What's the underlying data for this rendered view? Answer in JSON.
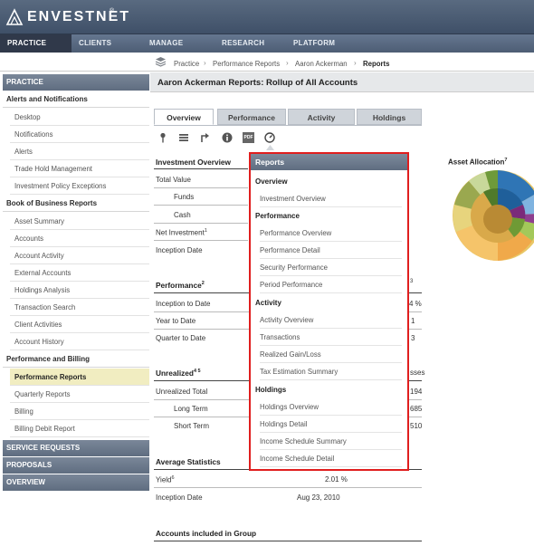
{
  "brand": {
    "name": "ENVESTNET",
    "tm": "®"
  },
  "nav": {
    "tabs": [
      {
        "label": "PRACTICE"
      },
      {
        "label": "CLIENTS"
      },
      {
        "label": "MANAGE"
      },
      {
        "label": "RESEARCH"
      },
      {
        "label": "PLATFORM"
      }
    ]
  },
  "breadcrumb": [
    "Practice",
    "Performance Reports",
    "Aaron Ackerman",
    "Reports"
  ],
  "sidebar": {
    "practice_title": "PRACTICE",
    "groups": [
      {
        "heading": "Alerts and Notifications",
        "items": [
          "Desktop",
          "Notifications",
          "Alerts",
          "Trade Hold Management",
          "Investment Policy Exceptions"
        ]
      },
      {
        "heading": "Book of Business Reports",
        "items": [
          "Asset Summary",
          "Accounts",
          "Account Activity",
          "External Accounts",
          "Holdings Analysis",
          "Transaction Search",
          "Client Activities",
          "Account History"
        ]
      },
      {
        "heading": "Performance and Billing",
        "items": [
          "Performance Reports",
          "Quarterly Reports",
          "Billing",
          "Billing Debit Report"
        ]
      }
    ],
    "bottom_sections": [
      "SERVICE REQUESTS",
      "PROPOSALS",
      "OVERVIEW"
    ]
  },
  "page": {
    "title": "Aaron Ackerman Reports: Rollup of All Accounts",
    "tabs": [
      "Overview",
      "Performance",
      "Activity",
      "Holdings"
    ],
    "toolbar_icons": [
      "pin-icon",
      "list-icon",
      "export-icon",
      "info-icon",
      "pdf-icon",
      "reports-icon"
    ],
    "toolbar_pdf_label": "PDF"
  },
  "overview": {
    "investment_overview_title": "Investment Overview",
    "investment_rows": [
      "Total Value",
      "Funds",
      "Cash",
      "Net Investment",
      "Inception Date"
    ],
    "net_investment_sup": "1",
    "performance_title": "Performance",
    "performance_sup": "2",
    "performance_right_sup": "3",
    "performance_rows": [
      "Inception to Date",
      "Year to Date",
      "Quarter to Date"
    ],
    "performance_values": [
      "4  %",
      "1",
      "3"
    ],
    "unrealized_title": "Unrealized",
    "unrealized_sup": "4 5",
    "unrealized_right": "sses",
    "unrealized_rows": [
      "Unrealized Total",
      "Long Term",
      "Short Term"
    ],
    "unrealized_values": [
      "194",
      "685",
      "510"
    ],
    "average_title": "Average Statistics",
    "yield_label": "Yield",
    "yield_sup": "6",
    "yield_value": "2.01  %",
    "inception_label": "Inception Date",
    "inception_value": "Aug 23, 2010",
    "accounts_title": "Accounts included in Group"
  },
  "reports_menu": {
    "title": "Reports",
    "groups": [
      {
        "label": "Overview",
        "items": [
          "Investment Overview"
        ]
      },
      {
        "label": "Performance",
        "items": [
          "Performance Overview",
          "Performance Detail",
          "Security Performance",
          "Period Performance"
        ]
      },
      {
        "label": "Activity",
        "items": [
          "Activity Overview",
          "Transactions",
          "Realized Gain/Loss",
          "Tax Estimation Summary"
        ]
      },
      {
        "label": "Holdings",
        "items": [
          "Holdings Overview",
          "Holdings Detail",
          "Income Schedule Summary",
          "Income Schedule Detail"
        ]
      }
    ]
  },
  "asset_allocation": {
    "title": "Asset Allocation",
    "sup": "7"
  },
  "colors": {
    "menu_border": "#e01e1e",
    "active_sidebar": "#f1edc1",
    "nav_active": "#30394a"
  }
}
